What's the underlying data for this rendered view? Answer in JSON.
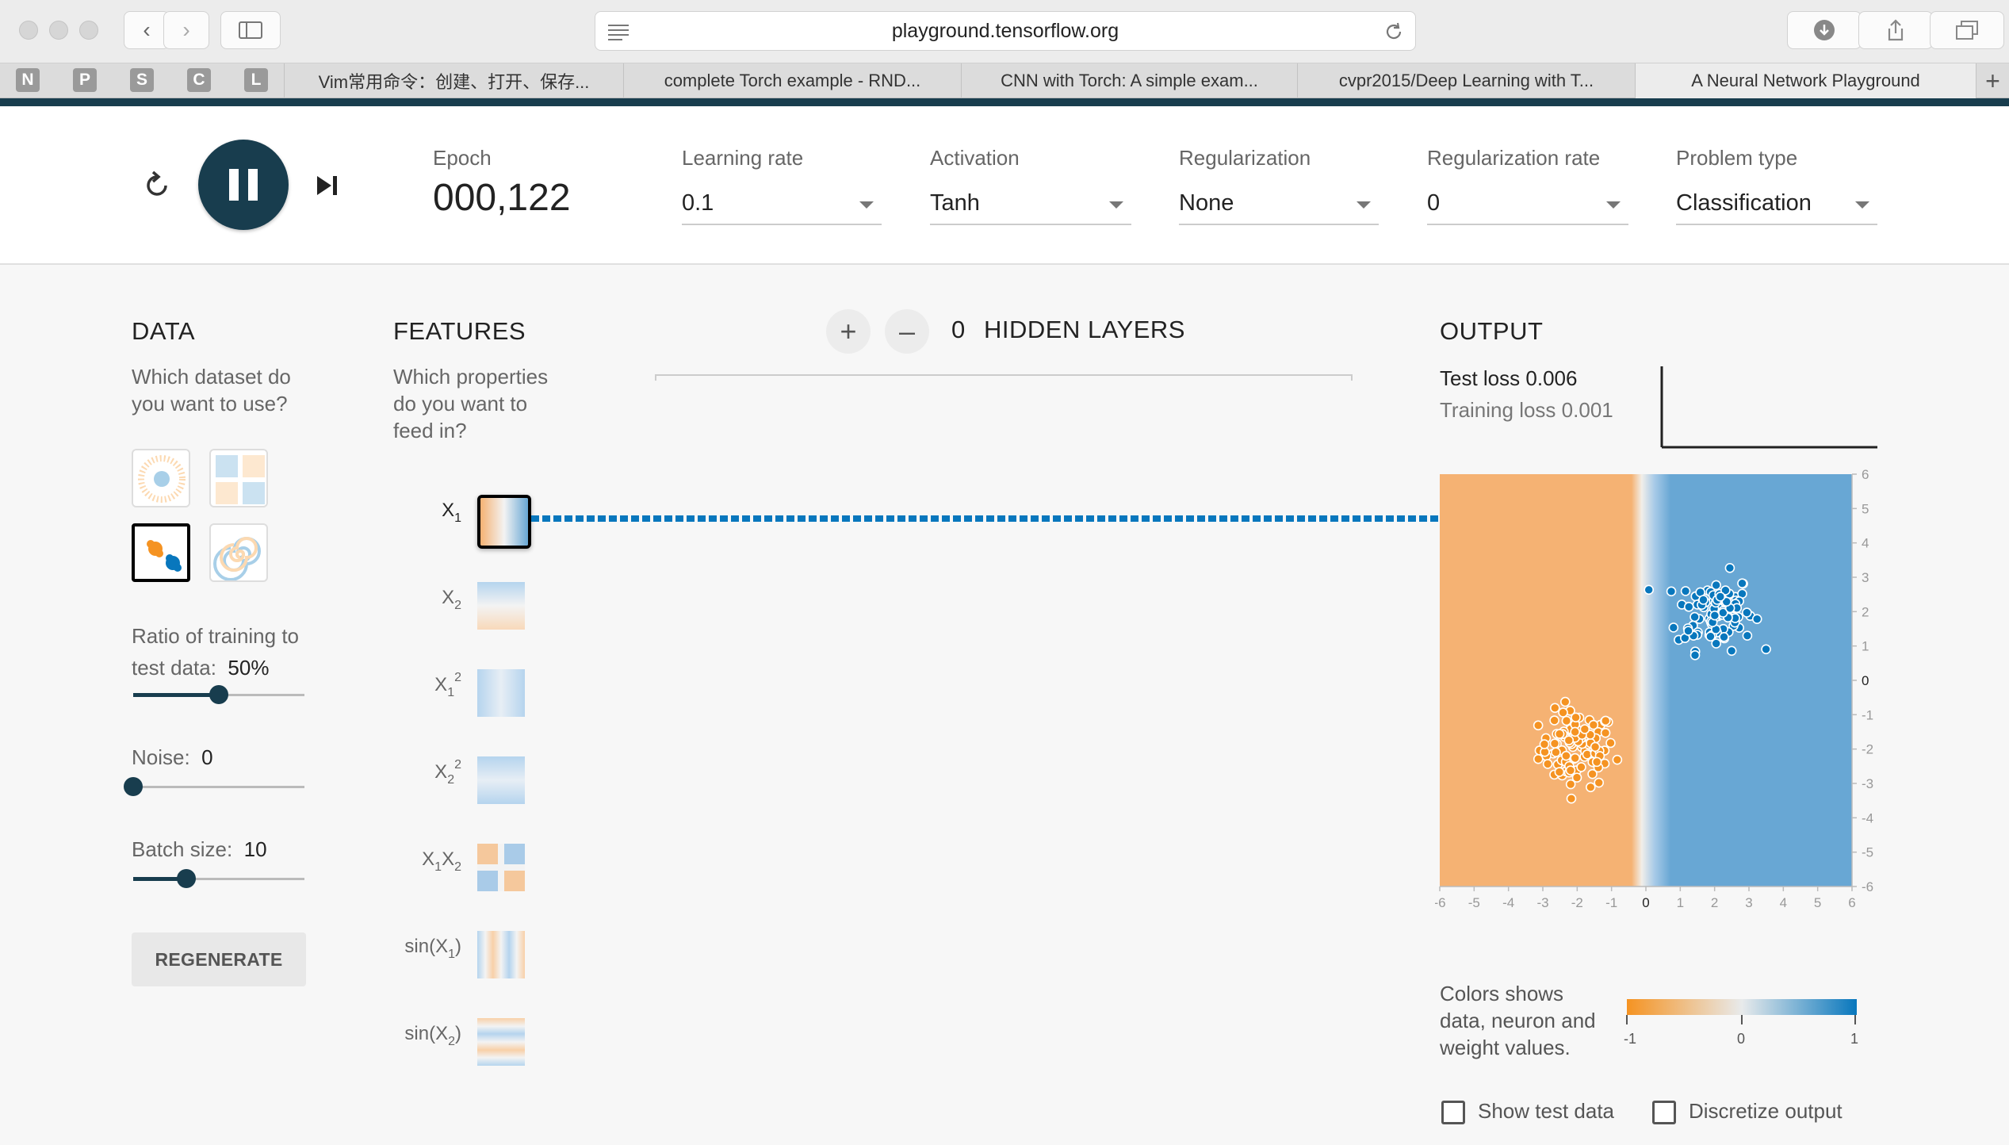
{
  "browser": {
    "url": "playground.tensorflow.org",
    "bookmarks": [
      "N",
      "P",
      "S",
      "C",
      "L"
    ],
    "tabs": [
      "Vim常用命令：创建、打开、保存...",
      "complete Torch example - RND...",
      "CNN with Torch: A simple exam...",
      "cvpr2015/Deep Learning with T...",
      "A Neural Network Playground"
    ],
    "active_tab": 4
  },
  "controls": {
    "epoch_label": "Epoch",
    "epoch_value": "000,122",
    "learning_rate": {
      "label": "Learning rate",
      "value": "0.1"
    },
    "activation": {
      "label": "Activation",
      "value": "Tanh"
    },
    "regularization": {
      "label": "Regularization",
      "value": "None"
    },
    "regularization_rate": {
      "label": "Regularization rate",
      "value": "0"
    },
    "problem_type": {
      "label": "Problem type",
      "value": "Classification"
    },
    "state": "playing"
  },
  "data_panel": {
    "title": "DATA",
    "description_lines": [
      "Which dataset do",
      "you want to use?"
    ],
    "datasets": [
      "circle",
      "xor",
      "gaussian",
      "spiral"
    ],
    "selected_dataset": "gaussian",
    "ratio_label": "Ratio of training to",
    "ratio_label2": "test data:",
    "ratio_value": "50%",
    "ratio_fraction": 0.5,
    "noise_label": "Noise:",
    "noise_value": "0",
    "noise_fraction": 0.0,
    "batch_label": "Batch size:",
    "batch_value": "10",
    "batch_fraction": 0.31,
    "regenerate_label": "REGENERATE"
  },
  "features_panel": {
    "title": "FEATURES",
    "description_lines": [
      "Which properties",
      "do you want to",
      "feed in?"
    ],
    "features": [
      {
        "base": "X",
        "sub": "1",
        "sup": "",
        "active": true
      },
      {
        "base": "X",
        "sub": "2",
        "sup": "",
        "active": false
      },
      {
        "base": "X",
        "sub": "1",
        "sup": "2",
        "active": false
      },
      {
        "base": "X",
        "sub": "2",
        "sup": "2",
        "active": false
      },
      {
        "base": "X",
        "sub": "1",
        "mid": "X",
        "sub2": "2",
        "active": false
      },
      {
        "base": "sin(X",
        "sub": "1",
        "tail": ")",
        "active": false
      },
      {
        "base": "sin(X",
        "sub": "2",
        "tail": ")",
        "active": false
      }
    ]
  },
  "hidden_layers": {
    "count": "0",
    "title": "HIDDEN LAYERS",
    "add_symbol": "+",
    "remove_symbol": "–"
  },
  "output_panel": {
    "title": "OUTPUT",
    "test_loss_label": "Test loss",
    "test_loss": "0.006",
    "training_loss_label": "Training loss",
    "training_loss": "0.001",
    "legend_lines": [
      "Colors shows",
      "data, neuron and",
      "weight values."
    ],
    "legend_ticks": [
      "-1",
      "0",
      "1"
    ],
    "show_test_label": "Show test data",
    "discretize_label": "Discretize output"
  },
  "colors": {
    "orange": "#f5b273",
    "blue": "#68a7d4",
    "dark_orange": "#f59322",
    "dark_blue": "#0877bd",
    "accent_dark": "#183d4e"
  },
  "chart_data": {
    "type": "scatter",
    "x_ticks": [
      "-6",
      "-5",
      "-4",
      "-3",
      "-2",
      "-1",
      "0",
      "1",
      "2",
      "3",
      "4",
      "5",
      "6"
    ],
    "y_ticks": [
      "6",
      "5",
      "4",
      "3",
      "2",
      "1",
      "0",
      "-1",
      "-2",
      "-3",
      "-4",
      "-5",
      "-6"
    ],
    "xlim": [
      -6,
      6
    ],
    "ylim": [
      -6,
      6
    ],
    "decision_boundary_x": 0,
    "series": [
      {
        "class": "orange",
        "center": [
          -2,
          -2
        ],
        "count": 100
      },
      {
        "class": "blue",
        "center": [
          2,
          2
        ],
        "count": 100
      }
    ]
  }
}
